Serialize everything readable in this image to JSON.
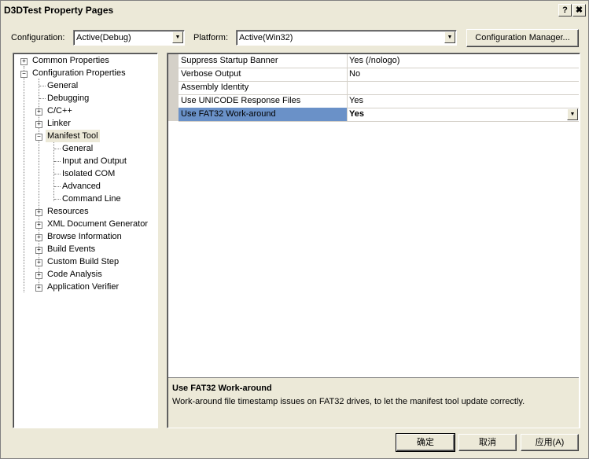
{
  "window": {
    "title": "D3DTest Property Pages",
    "help_label": "?",
    "close_label": "✖"
  },
  "configuration": {
    "label": "Configuration:",
    "value": "Active(Debug)"
  },
  "platform": {
    "label": "Platform:",
    "value": "Active(Win32)"
  },
  "config_manager_label": "Configuration Manager...",
  "tree": {
    "common_properties": "Common Properties",
    "configuration_properties": "Configuration Properties",
    "general": "General",
    "debugging": "Debugging",
    "cpp": "C/C++",
    "linker": "Linker",
    "manifest_tool": "Manifest Tool",
    "mt_general": "General",
    "mt_input_output": "Input and Output",
    "mt_isolated_com": "Isolated COM",
    "mt_advanced": "Advanced",
    "mt_command_line": "Command Line",
    "resources": "Resources",
    "xml_doc": "XML Document Generator",
    "browse_info": "Browse Information",
    "build_events": "Build Events",
    "custom_build": "Custom Build Step",
    "code_analysis": "Code Analysis",
    "app_verifier": "Application Verifier"
  },
  "grid": {
    "rows": [
      {
        "name": "Suppress Startup Banner",
        "value": "Yes (/nologo)"
      },
      {
        "name": "Verbose Output",
        "value": "No"
      },
      {
        "name": "Assembly Identity",
        "value": ""
      },
      {
        "name": "Use UNICODE Response Files",
        "value": "Yes"
      },
      {
        "name": "Use FAT32 Work-around",
        "value": "Yes"
      }
    ]
  },
  "description": {
    "title": "Use FAT32 Work-around",
    "text": "Work-around file timestamp issues on FAT32 drives, to let the manifest tool update correctly."
  },
  "buttons": {
    "ok": "确定",
    "cancel": "取消",
    "apply": "应用(A)"
  }
}
